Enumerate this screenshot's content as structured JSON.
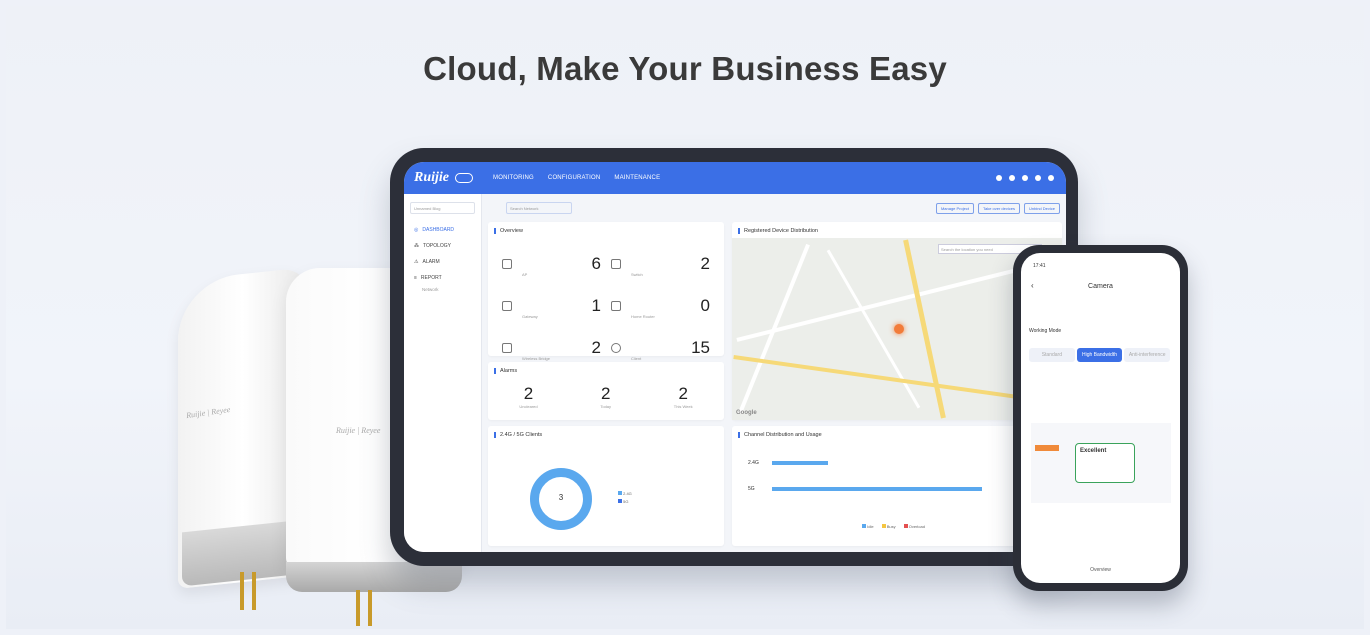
{
  "headline": "Cloud, Make Your Business Easy",
  "tablet": {
    "logo": "Ruijie",
    "nav": [
      "MONITORING",
      "CONFIGURATION",
      "MAINTENANCE"
    ],
    "sidebar": {
      "select": "Unnamed Blog",
      "items": [
        "DASHBOARD",
        "TOPOLOGY",
        "ALARM",
        "REPORT"
      ],
      "sub": "Network"
    },
    "search_placeholder": "Search Network",
    "toolbar_buttons": [
      "Manage Project",
      "Take over devices",
      "Unbind Device"
    ],
    "overview": {
      "title": "Overview",
      "cells": [
        {
          "label": "AP",
          "value": "6"
        },
        {
          "label": "Switch",
          "value": "2"
        },
        {
          "label": "Gateway",
          "value": "1"
        },
        {
          "label": "Home Router",
          "value": "0"
        },
        {
          "label": "Wireless Bridge",
          "value": "2"
        },
        {
          "label": "Client",
          "value": "15"
        }
      ]
    },
    "alarms": {
      "title": "Alarms",
      "cells": [
        {
          "label": "Uncleared",
          "value": "2"
        },
        {
          "label": "Today",
          "value": "2"
        },
        {
          "label": "This Week",
          "value": "2"
        }
      ]
    },
    "map": {
      "title": "Registered Device Distribution",
      "search": "Search the location you need",
      "provider": "Google"
    },
    "clients": {
      "title": "2.4G / 5G Clients",
      "total": "3",
      "total_label": "Total",
      "legend": [
        "2.4G",
        "5G"
      ]
    },
    "channel": {
      "title": "Channel Distribution and Usage",
      "bands": [
        "2.4G",
        "5G"
      ],
      "legend": [
        "Idle",
        "Busy",
        "Overload"
      ]
    }
  },
  "phone": {
    "time": "17:41",
    "title": "Camera",
    "mode_label": "Working Mode",
    "modes": [
      "Standard",
      "High Bandwidth",
      "Anti-interference"
    ],
    "status": "Excellent",
    "tab": "Overview"
  },
  "ap_brand": "Ruijie | Reyee",
  "colors": {
    "accent": "#3b6fe6",
    "donut": "#5aa8ee",
    "success": "#3aa35b"
  }
}
